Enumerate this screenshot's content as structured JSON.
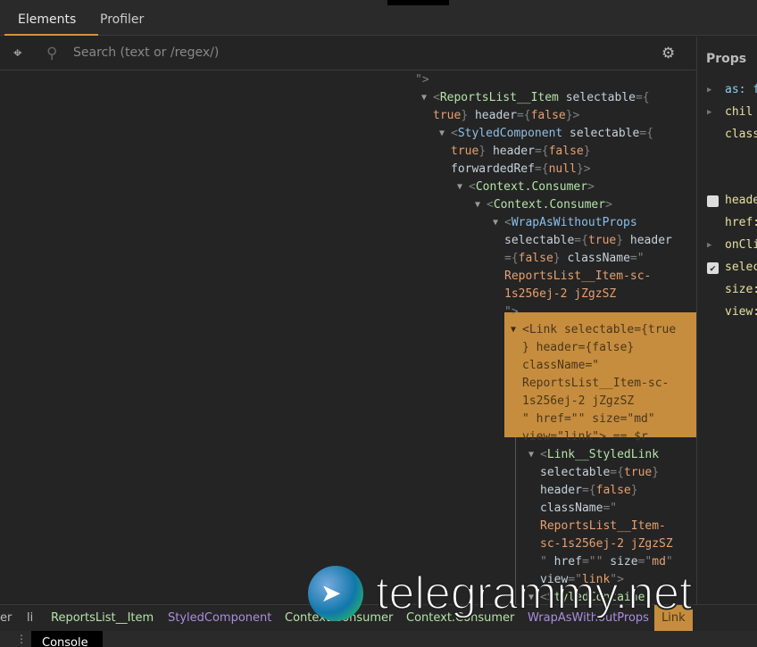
{
  "tabs": [
    {
      "label": "Elements",
      "active": true
    },
    {
      "label": "Profiler",
      "active": false
    }
  ],
  "search": {
    "placeholder": "Search (text or /regex/)",
    "select_icon": "target-icon",
    "search_icon": "search-icon",
    "settings_icon": "gear-icon"
  },
  "tree": {
    "lines": [
      {
        "depth": -1,
        "tokens": [
          [
            "p",
            "\">"
          ]
        ]
      },
      {
        "depth": 0,
        "arrow": true,
        "tokens": [
          [
            "p",
            "<"
          ],
          [
            "tag",
            "ReportsList__Item"
          ],
          [
            "attr",
            " selectable"
          ],
          [
            "p",
            "={"
          ]
        ]
      },
      {
        "depth": 0,
        "tokens": [
          [
            "val",
            "true"
          ],
          [
            "p",
            "}"
          ],
          [
            "attr",
            " header"
          ],
          [
            "p",
            "={"
          ],
          [
            "val",
            "false"
          ],
          [
            "p",
            "}>"
          ]
        ]
      },
      {
        "depth": 1,
        "arrow": true,
        "tokens": [
          [
            "p",
            "<"
          ],
          [
            "comp",
            "StyledComponent"
          ],
          [
            "attr",
            " selectable"
          ],
          [
            "p",
            "={"
          ]
        ]
      },
      {
        "depth": 1,
        "tokens": [
          [
            "val",
            "true"
          ],
          [
            "p",
            "}"
          ],
          [
            "attr",
            " header"
          ],
          [
            "p",
            "={"
          ],
          [
            "val",
            "false"
          ],
          [
            "p",
            "}"
          ]
        ]
      },
      {
        "depth": 1,
        "tokens": [
          [
            "attr",
            "forwardedRef"
          ],
          [
            "p",
            "={"
          ],
          [
            "val",
            "null"
          ],
          [
            "p",
            "}>"
          ]
        ]
      },
      {
        "depth": 2,
        "arrow": true,
        "tokens": [
          [
            "p",
            "<"
          ],
          [
            "tag",
            "Context.Consumer"
          ],
          [
            "p",
            ">"
          ]
        ]
      },
      {
        "depth": 3,
        "arrow": true,
        "tokens": [
          [
            "p",
            "<"
          ],
          [
            "tag",
            "Context.Consumer"
          ],
          [
            "p",
            ">"
          ]
        ]
      },
      {
        "depth": 4,
        "arrow": true,
        "tokens": [
          [
            "p",
            "<"
          ],
          [
            "comp",
            "WrapAsWithoutProps"
          ]
        ]
      },
      {
        "depth": 4,
        "tokens": [
          [
            "attr",
            "selectable"
          ],
          [
            "p",
            "={"
          ],
          [
            "val",
            "true"
          ],
          [
            "p",
            "}"
          ],
          [
            "attr",
            " header"
          ]
        ]
      },
      {
        "depth": 4,
        "tokens": [
          [
            "p",
            "={"
          ],
          [
            "val",
            "false"
          ],
          [
            "p",
            "}"
          ],
          [
            "attr",
            " className"
          ],
          [
            "p",
            "=\""
          ]
        ]
      },
      {
        "depth": 4,
        "tokens": [
          [
            "val",
            "ReportsList__Item-sc-"
          ]
        ]
      },
      {
        "depth": 4,
        "tokens": [
          [
            "val",
            "1s256ej-2 jZgzSZ"
          ]
        ]
      },
      {
        "depth": 4,
        "tokens": [
          [
            "p",
            "\">"
          ]
        ]
      }
    ],
    "selected": [
      {
        "depth": 5,
        "arrow": true,
        "tokens": [
          [
            "p",
            "<Link selectable={true"
          ]
        ]
      },
      {
        "depth": 5,
        "tokens": [
          [
            "p",
            "} header={false}"
          ]
        ]
      },
      {
        "depth": 5,
        "tokens": [
          [
            "p",
            "className=\""
          ]
        ]
      },
      {
        "depth": 5,
        "tokens": [
          [
            "p",
            "ReportsList__Item-sc-"
          ]
        ]
      },
      {
        "depth": 5,
        "tokens": [
          [
            "p",
            "1s256ej-2 jZgzSZ"
          ]
        ]
      },
      {
        "depth": 5,
        "tokens": [
          [
            "p",
            "\" href=\"\" size=\"md\""
          ]
        ]
      },
      {
        "depth": 5,
        "tokens": [
          [
            "p",
            "view=\"link\"> == $r"
          ]
        ]
      }
    ],
    "after": [
      {
        "depth": 6,
        "arrow": true,
        "tokens": [
          [
            "p",
            "<"
          ],
          [
            "tag",
            "Link__StyledLink"
          ]
        ]
      },
      {
        "depth": 6,
        "tokens": [
          [
            "attr",
            "selectable"
          ],
          [
            "p",
            "={"
          ],
          [
            "val",
            "true"
          ],
          [
            "p",
            "}"
          ]
        ]
      },
      {
        "depth": 6,
        "tokens": [
          [
            "attr",
            "header"
          ],
          [
            "p",
            "={"
          ],
          [
            "val",
            "false"
          ],
          [
            "p",
            "}"
          ]
        ]
      },
      {
        "depth": 6,
        "tokens": [
          [
            "attr",
            "className"
          ],
          [
            "p",
            "=\""
          ]
        ]
      },
      {
        "depth": 6,
        "tokens": [
          [
            "val",
            "ReportsList__Item-"
          ]
        ]
      },
      {
        "depth": 6,
        "tokens": [
          [
            "val",
            "sc-1s256ej-2 jZgzSZ"
          ]
        ]
      },
      {
        "depth": 6,
        "tokens": [
          [
            "p",
            "\""
          ],
          [
            "attr",
            " href"
          ],
          [
            "p",
            "=\"\""
          ],
          [
            "attr",
            " size"
          ],
          [
            "p",
            "=\""
          ],
          [
            "val",
            "md"
          ],
          [
            "p",
            "\""
          ]
        ]
      },
      {
        "depth": 6,
        "tokens": [
          [
            "attr",
            "view"
          ],
          [
            "p",
            "=\""
          ],
          [
            "val",
            "link"
          ],
          [
            "p",
            "\">"
          ]
        ]
      },
      {
        "depth": 6,
        "arrow": true,
        "tokens": [
          [
            "p",
            "<"
          ],
          [
            "tag",
            "StyledContainer"
          ]
        ]
      }
    ]
  },
  "props": {
    "title": "Props",
    "rows": [
      {
        "label": "as: f",
        "kind": "expand",
        "blue": true
      },
      {
        "label": "chil",
        "kind": "expand"
      },
      {
        "label": "class",
        "kind": "none"
      },
      {
        "label": "heade",
        "kind": "checkbox",
        "checked": false
      },
      {
        "label": "href:",
        "kind": "none"
      },
      {
        "label": "onCli",
        "kind": "expand"
      },
      {
        "label": "selec",
        "kind": "checkbox",
        "checked": true
      },
      {
        "label": "size:",
        "kind": "none"
      },
      {
        "label": "view:",
        "kind": "none"
      }
    ]
  },
  "breadcrumbs": [
    {
      "label": "er",
      "style": "gray"
    },
    {
      "label": "li",
      "style": "gray"
    },
    {
      "label": "ReportsList__Item",
      "style": "green"
    },
    {
      "label": "StyledComponent",
      "style": "purple"
    },
    {
      "label": "Context.Consumer",
      "style": "green"
    },
    {
      "label": "Context.Consumer",
      "style": "green"
    },
    {
      "label": "WrapAsWithoutProps",
      "style": "purple"
    },
    {
      "label": "Link",
      "style": "sel"
    }
  ],
  "console": {
    "tab": "Console",
    "menu_icon": "kebab-icon"
  },
  "watermark": {
    "text": "telegrammy.net"
  },
  "colors": {
    "accent": "#c68d3e",
    "tag": "#b4e3a8",
    "value": "#e6a070"
  }
}
